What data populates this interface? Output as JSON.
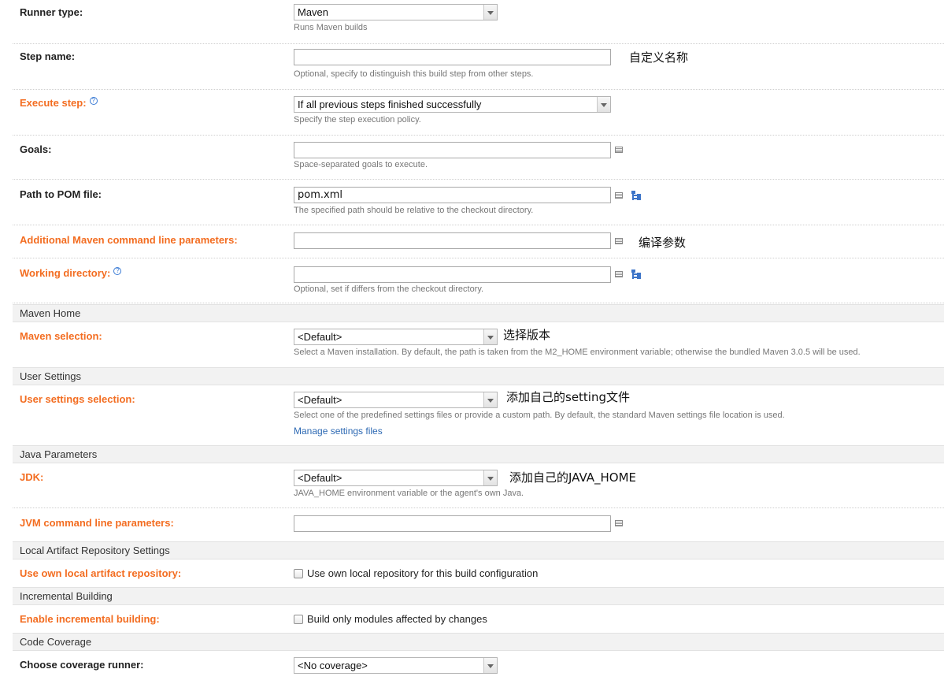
{
  "runner_type": {
    "label": "Runner type:",
    "value": "Maven",
    "hint": "Runs Maven builds"
  },
  "step_name": {
    "label": "Step name:",
    "value": "",
    "hint": "Optional, specify to distinguish this build step from other steps.",
    "note": "自定义名称"
  },
  "execute_step": {
    "label": "Execute step:",
    "value": "If all previous steps finished successfully",
    "hint": "Specify the step execution policy."
  },
  "goals": {
    "label": "Goals:",
    "value": "",
    "hint": "Space-separated goals to execute."
  },
  "pom_path": {
    "label": "Path to POM file:",
    "value": "pom.xml",
    "hint": "The specified path should be relative to the checkout directory."
  },
  "maven_params": {
    "label": "Additional Maven command line parameters:",
    "value": "",
    "note": "编译参数"
  },
  "working_dir": {
    "label": "Working directory:",
    "value": "",
    "hint": "Optional, set if differs from the checkout directory."
  },
  "sections": {
    "maven_home": "Maven Home",
    "user_settings": "User Settings",
    "java_params": "Java Parameters",
    "local_repo": "Local Artifact Repository Settings",
    "incremental": "Incremental Building",
    "coverage": "Code Coverage"
  },
  "maven_selection": {
    "label": "Maven selection:",
    "value": "<Default>",
    "hint": "Select a Maven installation. By default, the path is taken from the M2_HOME environment variable; otherwise the bundled Maven 3.0.5 will be used.",
    "note": "选择版本"
  },
  "user_settings_selection": {
    "label": "User settings selection:",
    "value": "<Default>",
    "hint": "Select one of the predefined settings files or provide a custom path. By default, the standard Maven settings file location is used.",
    "link": "Manage settings files",
    "note": "添加自己的setting文件"
  },
  "jdk": {
    "label": "JDK:",
    "value": "<Default>",
    "hint": "JAVA_HOME environment variable or the agent's own Java.",
    "note": "添加自己的JAVA_HOME"
  },
  "jvm_params": {
    "label": "JVM command line parameters:",
    "value": ""
  },
  "local_repo": {
    "label": "Use own local artifact repository:",
    "checkbox_label": "Use own local repository for this build configuration",
    "checked": false
  },
  "incremental": {
    "label": "Enable incremental building:",
    "checkbox_label": "Build only modules affected by changes",
    "checked": false
  },
  "coverage_runner": {
    "label": "Choose coverage runner:",
    "value": "<No coverage>"
  },
  "colors": {
    "accent_label": "#f36d21",
    "link": "#2d69b3",
    "section_bg": "#f2f2f2"
  }
}
